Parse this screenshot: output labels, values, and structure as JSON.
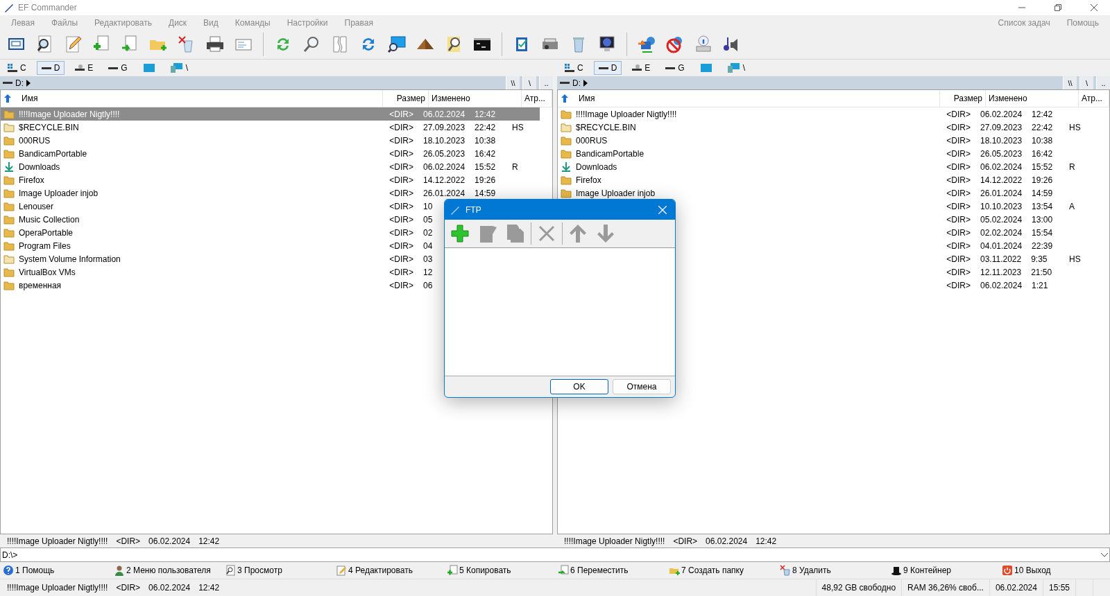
{
  "window": {
    "title": "EF Commander"
  },
  "menu": [
    {
      "label": "Левая"
    },
    {
      "label": "Файлы"
    },
    {
      "label": "Редактировать"
    },
    {
      "label": "Диск"
    },
    {
      "label": "Вид"
    },
    {
      "label": "Команды"
    },
    {
      "label": "Настройки"
    },
    {
      "label": "Правая"
    }
  ],
  "menu_right": [
    {
      "label": "Список задач"
    },
    {
      "label": "Помощь"
    }
  ],
  "panels": [
    {
      "drives": [
        {
          "label": "C",
          "kind": "system",
          "selected": false
        },
        {
          "label": "D",
          "kind": "disk",
          "selected": true
        },
        {
          "label": "E",
          "kind": "removable",
          "selected": false
        },
        {
          "label": "G",
          "kind": "disk",
          "selected": false
        },
        {
          "kind": "screen",
          "selected": false
        },
        {
          "label": "\\",
          "kind": "network",
          "selected": false
        }
      ],
      "path": "D:",
      "path_buttons": [
        "\\\\",
        "\\",
        ".."
      ],
      "columns": [
        "Имя",
        "Размер",
        "Изменено",
        "Атр..."
      ],
      "rows": [
        {
          "name": "!!!!Image Uploader Nigtly!!!!",
          "kind": "folder",
          "size": "<DIR>",
          "date": "06.02.2024",
          "time": "12:42",
          "selected": true
        },
        {
          "name": "$RECYCLE.BIN",
          "kind": "hidden",
          "size": "<DIR>",
          "date": "27.09.2023",
          "time": "22:42",
          "attr": "HS",
          "selected": false
        },
        {
          "name": "000RUS",
          "kind": "folder",
          "size": "<DIR>",
          "date": "18.10.2023",
          "time": "10:38",
          "selected": false
        },
        {
          "name": "BandicamPortable",
          "kind": "folder",
          "size": "<DIR>",
          "date": "26.05.2023",
          "time": "16:42",
          "selected": false
        },
        {
          "name": "Downloads",
          "kind": "downloads",
          "size": "<DIR>",
          "date": "06.02.2024",
          "time": "15:52",
          "attr": "R",
          "selected": false
        },
        {
          "name": "Firefox",
          "kind": "folder",
          "size": "<DIR>",
          "date": "14.12.2022",
          "time": "19:26",
          "selected": false
        },
        {
          "name": "Image Uploader injob",
          "kind": "folder",
          "size": "<DIR>",
          "date": "26.01.2024",
          "time": "14:59",
          "selected": false
        },
        {
          "name": "Lenouser",
          "kind": "folder",
          "size": "<DIR>",
          "date": "10",
          "selected": false
        },
        {
          "name": "Music Collection",
          "kind": "folder",
          "size": "<DIR>",
          "date": "05",
          "selected": false
        },
        {
          "name": "OperaPortable",
          "kind": "folder",
          "size": "<DIR>",
          "date": "02",
          "selected": false
        },
        {
          "name": "Program Files",
          "kind": "folder",
          "size": "<DIR>",
          "date": "04",
          "selected": false
        },
        {
          "name": "System Volume Information",
          "kind": "hidden",
          "size": "<DIR>",
          "date": "03",
          "selected": false
        },
        {
          "name": "VirtualBox VMs",
          "kind": "folder",
          "size": "<DIR>",
          "date": "12",
          "selected": false
        },
        {
          "name": "временная",
          "kind": "folder",
          "size": "<DIR>",
          "date": "06",
          "selected": false
        }
      ],
      "info": {
        "name": "!!!!Image Uploader Nigtly!!!!",
        "size": "<DIR>",
        "date": "06.02.2024",
        "time": "12:42"
      }
    },
    {
      "drives": [
        {
          "label": "C",
          "kind": "system",
          "selected": false
        },
        {
          "label": "D",
          "kind": "disk",
          "selected": true
        },
        {
          "label": "E",
          "kind": "removable",
          "selected": false
        },
        {
          "label": "G",
          "kind": "disk",
          "selected": false
        },
        {
          "kind": "screen",
          "selected": false
        },
        {
          "label": "\\",
          "kind": "network",
          "selected": false
        }
      ],
      "path": "D:",
      "path_buttons": [
        "\\\\",
        "\\",
        ".."
      ],
      "columns": [
        "Имя",
        "Размер",
        "Изменено",
        "Атр..."
      ],
      "rows": [
        {
          "name": "!!!!Image Uploader Nigtly!!!!",
          "kind": "folder",
          "size": "<DIR>",
          "date": "06.02.2024",
          "time": "12:42",
          "selected": false
        },
        {
          "name": "$RECYCLE.BIN",
          "kind": "hidden",
          "size": "<DIR>",
          "date": "27.09.2023",
          "time": "22:42",
          "attr": "HS",
          "selected": false
        },
        {
          "name": "000RUS",
          "kind": "folder",
          "size": "<DIR>",
          "date": "18.10.2023",
          "time": "10:38",
          "selected": false
        },
        {
          "name": "BandicamPortable",
          "kind": "folder",
          "size": "<DIR>",
          "date": "26.05.2023",
          "time": "16:42",
          "selected": false
        },
        {
          "name": "Downloads",
          "kind": "downloads",
          "size": "<DIR>",
          "date": "06.02.2024",
          "time": "15:52",
          "attr": "R",
          "selected": false
        },
        {
          "name": "Firefox",
          "kind": "folder",
          "size": "<DIR>",
          "date": "14.12.2022",
          "time": "19:26",
          "selected": false
        },
        {
          "name": "Image Uploader injob",
          "kind": "folder",
          "size": "<DIR>",
          "date": "26.01.2024",
          "time": "14:59",
          "selected": false
        },
        {
          "size": "<DIR>",
          "date": "10.10.2023",
          "time": "13:54",
          "attr": "A",
          "selected": false
        },
        {
          "size": "<DIR>",
          "date": "05.02.2024",
          "time": "13:00",
          "selected": false
        },
        {
          "size": "<DIR>",
          "date": "02.02.2024",
          "time": "15:54",
          "selected": false
        },
        {
          "size": "<DIR>",
          "date": "04.01.2024",
          "time": "22:39",
          "selected": false
        },
        {
          "size": "<DIR>",
          "date": "03.11.2022",
          "time": "9:35",
          "attr": "HS",
          "selected": false
        },
        {
          "size": "<DIR>",
          "date": "12.11.2023",
          "time": "21:50",
          "selected": false
        },
        {
          "size": "<DIR>",
          "date": "06.02.2024",
          "time": "1:21",
          "selected": false
        }
      ],
      "info": {
        "name": "!!!!Image Uploader Nigtly!!!!",
        "size": "<DIR>",
        "date": "06.02.2024",
        "time": "12:42"
      }
    }
  ],
  "command_line": {
    "value": "D:\\>"
  },
  "function_keys": [
    {
      "label": "1 Помощь",
      "kind": "help"
    },
    {
      "label": "2 Меню пользователя",
      "kind": "user"
    },
    {
      "label": "3 Просмотр",
      "kind": "view"
    },
    {
      "label": "4 Редактировать",
      "kind": "edit"
    },
    {
      "label": "5 Копировать",
      "kind": "copy"
    },
    {
      "label": "6 Переместить",
      "kind": "move"
    },
    {
      "label": "7 Создать папку",
      "kind": "folder"
    },
    {
      "label": "8 Удалить",
      "kind": "delete"
    },
    {
      "label": "9 Контейнер",
      "kind": "hat"
    },
    {
      "label": "10 Выход",
      "kind": "exit"
    }
  ],
  "status_bar": {
    "name": "!!!!Image Uploader Nigtly!!!!",
    "size": "<DIR>",
    "date": "06.02.2024",
    "time": "12:42",
    "cells": [
      "48,92 GB свободно",
      "RAM 36,26% своб...",
      "06.02.2024",
      "15:55"
    ]
  },
  "dialog": {
    "title": "FTP",
    "tools": [
      {
        "kind": "add",
        "disabled": false
      },
      {
        "kind": "edit",
        "disabled": true
      },
      {
        "kind": "copy",
        "disabled": true
      },
      {
        "kind": "separator"
      },
      {
        "kind": "delete",
        "disabled": true
      },
      {
        "kind": "separator"
      },
      {
        "kind": "up",
        "disabled": true
      },
      {
        "kind": "down",
        "disabled": true
      }
    ],
    "buttons": [
      {
        "label": "OK",
        "default": true
      },
      {
        "label": "Отмена",
        "default": false
      }
    ]
  }
}
